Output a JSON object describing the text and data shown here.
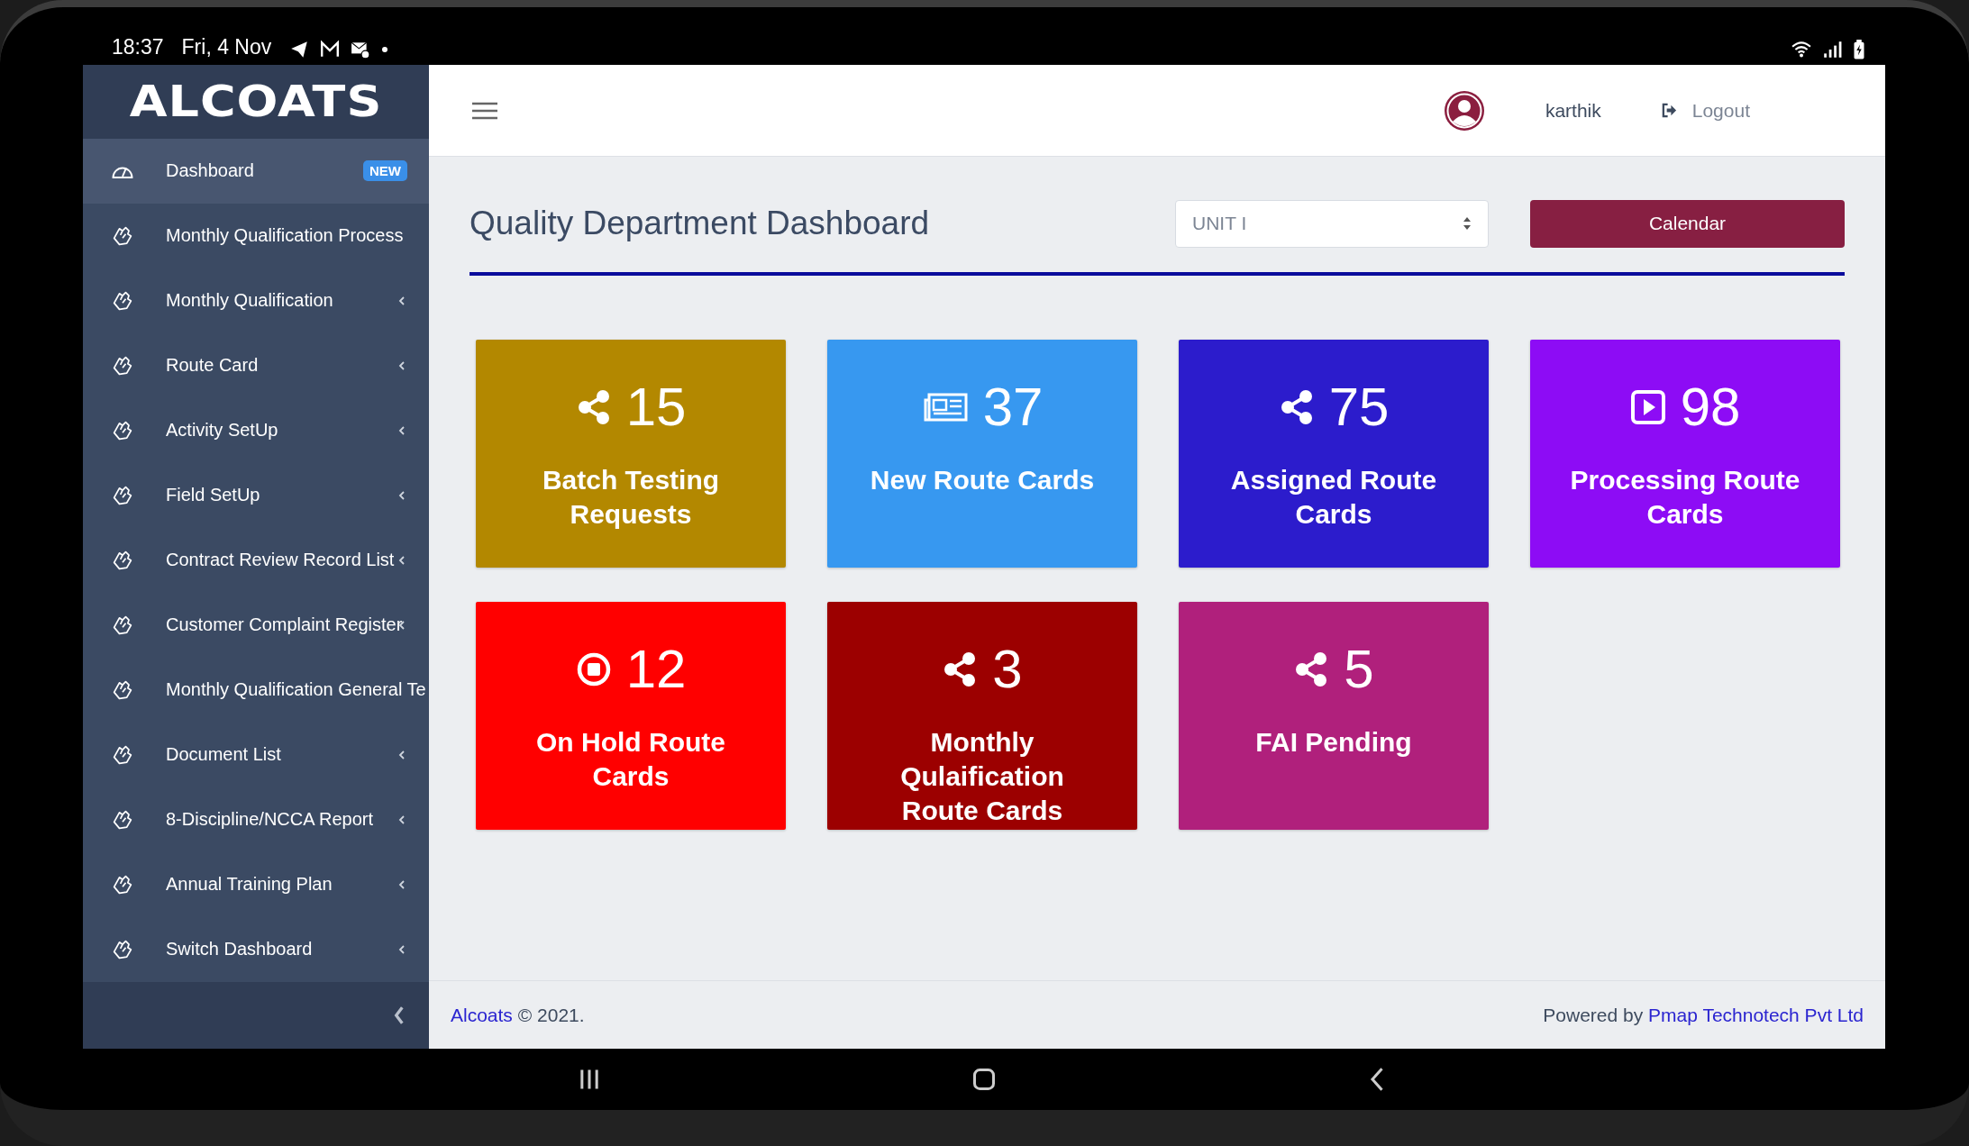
{
  "status_bar": {
    "time": "18:37",
    "date": "Fri, 4 Nov"
  },
  "sidebar": {
    "logo": "ALCOATS",
    "items": [
      {
        "label": "Dashboard",
        "selected": true,
        "badge": "NEW",
        "submenu": false,
        "kind": "dashboard"
      },
      {
        "label": "Monthly Qualification Process",
        "selected": false,
        "submenu": false,
        "kind": "module"
      },
      {
        "label": "Monthly Qualification",
        "selected": false,
        "submenu": true,
        "kind": "module"
      },
      {
        "label": "Route Card",
        "selected": false,
        "submenu": true,
        "kind": "module"
      },
      {
        "label": "Activity SetUp",
        "selected": false,
        "submenu": true,
        "kind": "module"
      },
      {
        "label": "Field SetUp",
        "selected": false,
        "submenu": true,
        "kind": "module"
      },
      {
        "label": "Contract Review Record List",
        "selected": false,
        "submenu": true,
        "kind": "module"
      },
      {
        "label": "Customer Complaint Register",
        "selected": false,
        "submenu": true,
        "kind": "module"
      },
      {
        "label": "Monthly Qualification General Te",
        "selected": false,
        "submenu": false,
        "kind": "module"
      },
      {
        "label": "Document List",
        "selected": false,
        "submenu": true,
        "kind": "module"
      },
      {
        "label": "8-Discipline/NCCA Report",
        "selected": false,
        "submenu": true,
        "kind": "module"
      },
      {
        "label": "Annual Training Plan",
        "selected": false,
        "submenu": true,
        "kind": "module"
      },
      {
        "label": "Switch Dashboard",
        "selected": false,
        "submenu": true,
        "kind": "module"
      }
    ]
  },
  "header": {
    "user": "karthik",
    "logout": "Logout"
  },
  "page": {
    "title": "Quality Department Dashboard",
    "unit_select": {
      "value": "UNIT I"
    },
    "calendar_button": "Calendar"
  },
  "cards": [
    {
      "kind": "share",
      "count": "15",
      "label": "Batch Testing Requests",
      "color": "#b38800"
    },
    {
      "kind": "newspaper",
      "count": "37",
      "label": "New Route Cards",
      "color": "#3798f0"
    },
    {
      "kind": "share",
      "count": "75",
      "label": "Assigned Route Cards",
      "color": "#2c1ccc"
    },
    {
      "kind": "play",
      "count": "98",
      "label": "Processing Route Cards",
      "color": "#8d0cf5"
    },
    {
      "kind": "stop",
      "count": "12",
      "label": "On Hold Route Cards",
      "color": "#ff0000"
    },
    {
      "kind": "share",
      "count": "3",
      "label": "Monthly Qulaification Route Cards",
      "color": "#9c0000"
    },
    {
      "kind": "share",
      "count": "5",
      "label": "FAI Pending",
      "color": "#b0207c"
    }
  ],
  "footer": {
    "brand": "Alcoats",
    "copyright": " © 2021.",
    "powered_by": "Powered by ",
    "company": "Pmap Technotech Pvt Ltd"
  }
}
